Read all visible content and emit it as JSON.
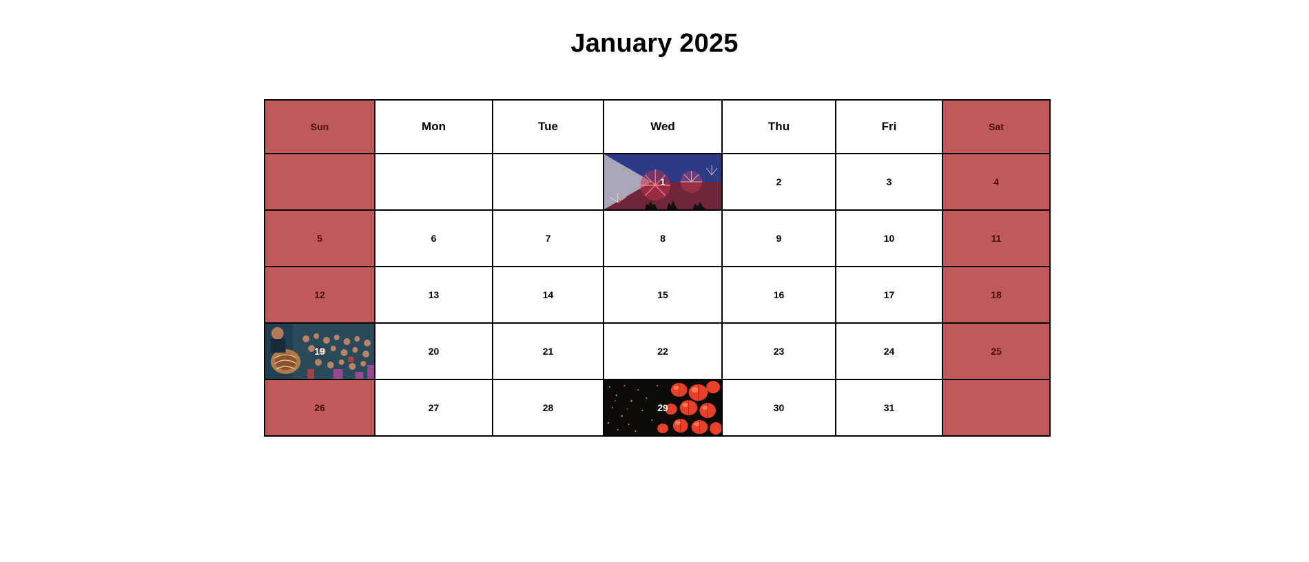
{
  "page": {
    "title": "January 2025"
  },
  "calendar": {
    "weekdays": [
      "Sun",
      "Mon",
      "Tue",
      "Wed",
      "Thu",
      "Fri",
      "Sat"
    ],
    "weeks": [
      [
        "",
        "",
        "",
        "1",
        "2",
        "3",
        "4"
      ],
      [
        "5",
        "6",
        "7",
        "8",
        "9",
        "10",
        "11"
      ],
      [
        "12",
        "13",
        "14",
        "15",
        "16",
        "17",
        "18"
      ],
      [
        "19",
        "20",
        "21",
        "22",
        "23",
        "24",
        "25"
      ],
      [
        "26",
        "27",
        "28",
        "29",
        "30",
        "31",
        ""
      ]
    ],
    "image_days": {
      "1": "fireworks-flag-image",
      "19": "festival-crowd-image",
      "29": "red-lanterns-image"
    },
    "colors": {
      "weekend_bg": "#c05a58",
      "weekend_text": "#4a0c0c",
      "weekday_bg": "#ffffff",
      "border": "#000000"
    }
  }
}
